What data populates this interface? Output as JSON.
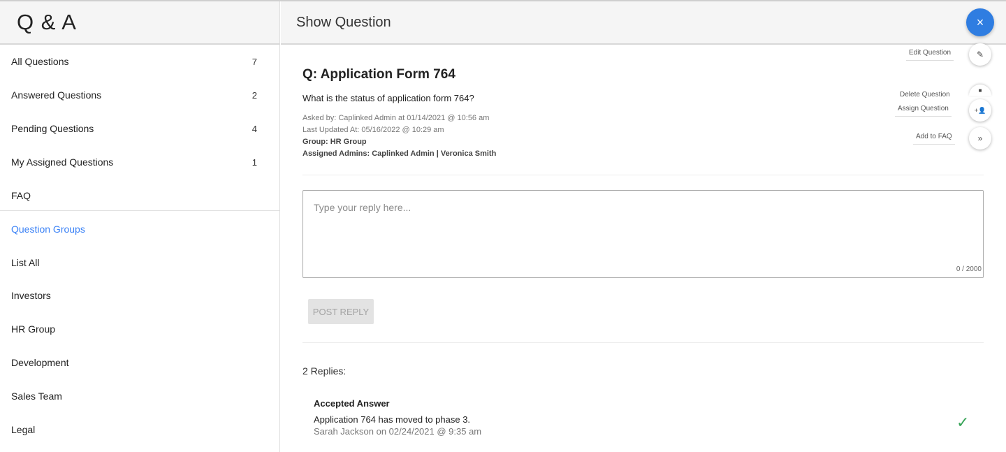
{
  "sidebar": {
    "title": "Q & A",
    "items": [
      {
        "label": "All Questions",
        "count": "7"
      },
      {
        "label": "Answered Questions",
        "count": "2"
      },
      {
        "label": "Pending Questions",
        "count": "4"
      },
      {
        "label": "My Assigned Questions",
        "count": "1"
      },
      {
        "label": "FAQ",
        "count": ""
      }
    ],
    "groups_label": "Question Groups",
    "groups": [
      {
        "label": "List All"
      },
      {
        "label": "Investors"
      },
      {
        "label": "HR Group"
      },
      {
        "label": "Development"
      },
      {
        "label": "Sales Team"
      },
      {
        "label": "Legal"
      }
    ]
  },
  "header": {
    "title": "Show Question",
    "close_icon": "×"
  },
  "question": {
    "title": "Q: Application Form 764",
    "body": "What is the status of application form 764?",
    "asked_by": "Asked by: Caplinked Admin at 01/14/2021 @ 10:56 am",
    "last_updated": "Last Updated At: 05/16/2022 @ 10:29 am",
    "group": "Group: HR Group",
    "assigned_admins": "Assigned Admins: Caplinked Admin | Veronica Smith"
  },
  "actions": {
    "edit": {
      "label": "Edit Question",
      "icon": "✎"
    },
    "delete": {
      "label": "Delete Question",
      "icon": "■"
    },
    "assign": {
      "label": "Assign Question",
      "icon": "+👤"
    },
    "faq": {
      "label": "Add to FAQ",
      "icon": "»"
    }
  },
  "reply": {
    "placeholder": "Type your reply here...",
    "counter": "0 / 2000",
    "post_label": "POST REPLY"
  },
  "replies": {
    "count_label": "2 Replies:",
    "accepted": {
      "heading": "Accepted Answer",
      "text": "Application 764 has moved to phase 3.",
      "meta": "Sarah Jackson on 02/24/2021 @ 9:35 am",
      "status_icon": "✓",
      "status_color": "#3aa55a"
    }
  },
  "colors": {
    "accent": "#3b82f6",
    "fab": "#2f7de1"
  }
}
